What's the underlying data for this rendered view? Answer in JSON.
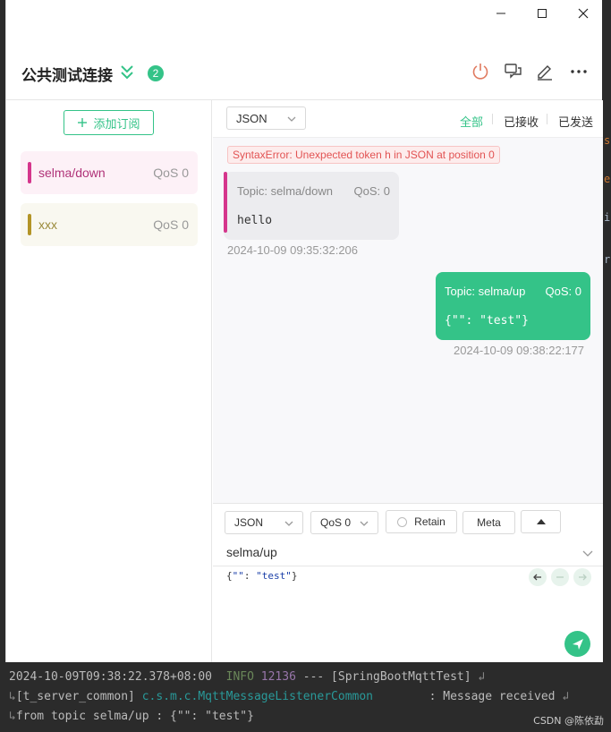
{
  "window": {
    "minimize": "—",
    "maximize": "☐",
    "close": "✕"
  },
  "header": {
    "title": "公共测试连接",
    "badge": "2"
  },
  "left": {
    "add_subscription": "添加订阅",
    "subscriptions": [
      {
        "topic": "selma/down",
        "qos": "QoS 0",
        "color": "#d5368c",
        "bg": "#fdf1f7",
        "text": "#b03278"
      },
      {
        "topic": "xxx",
        "qos": "QoS 0",
        "color": "#b39427",
        "bg": "#f9f8f0",
        "text": "#9a8a3a"
      }
    ]
  },
  "toolbar": {
    "format": "JSON",
    "filters": {
      "all": "全部",
      "received": "已接收",
      "sent": "已发送"
    }
  },
  "messages": {
    "error": "SyntaxError: Unexpected token h in JSON at position 0",
    "incoming": {
      "topic": "Topic: selma/down",
      "qos": "QoS: 0",
      "payload": "hello",
      "time": "2024-10-09 09:35:32:206"
    },
    "outgoing": {
      "topic": "Topic: selma/up",
      "qos": "QoS: 0",
      "payload": "{\"\": \"test\"}",
      "time": "2024-10-09 09:38:22:177"
    }
  },
  "composer": {
    "format": "JSON",
    "qos": "QoS 0",
    "retain": "Retain",
    "meta": "Meta",
    "topic": "selma/up",
    "payload_open": "{",
    "payload_key": "\"\"",
    "payload_colon": ": ",
    "payload_value": "\"test\"",
    "payload_close": "}"
  },
  "console": {
    "line1_ts": "2024-10-09T09:38:22.378+08:00  ",
    "line1_level": "INFO",
    "line1_pid": " 12136",
    "line1_rest": " --- [SpringBootMqttTest] ",
    "line2_thread": "[t_server_common] ",
    "line2_class": "c.s.m.c.MqttMessageListenerCommon",
    "line2_rest": "        : Message received ",
    "line3": "from topic selma/up : {\"\": \"test\"}",
    "credit": "CSDN @陈依勐"
  },
  "colors": {
    "accent": "#34c388",
    "incoming_bar": "#d5368c",
    "error": "#e25353"
  }
}
